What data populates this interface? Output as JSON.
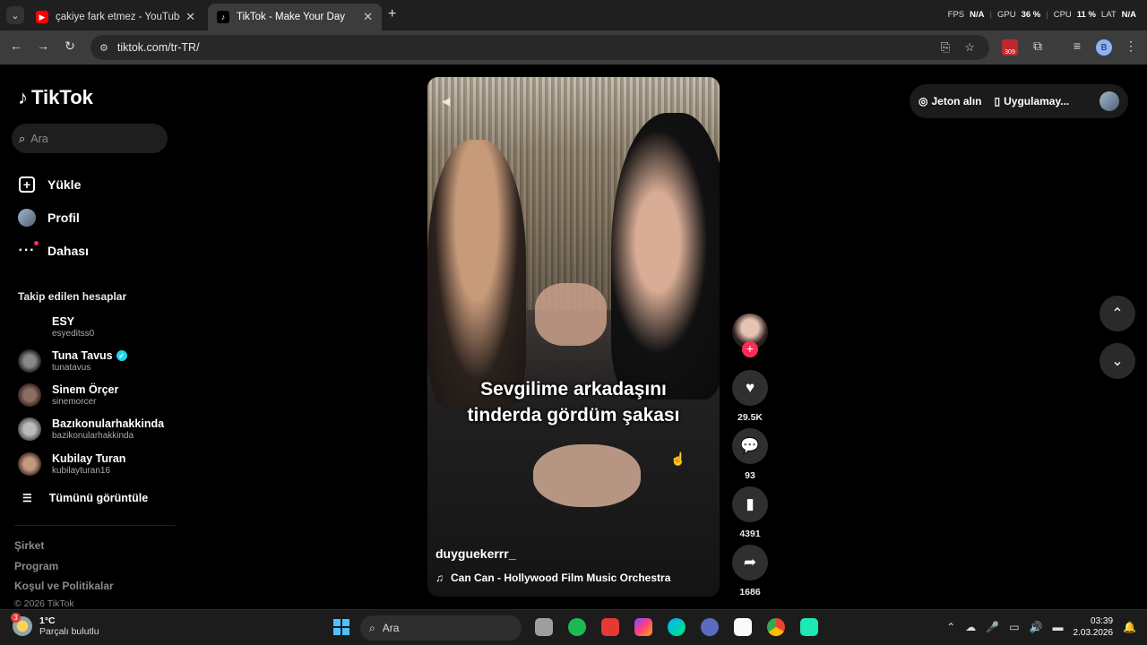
{
  "browser": {
    "tabs": [
      {
        "title": "çakiye fark etmez - YouTube",
        "favicon": "youtube-icon",
        "active": false
      },
      {
        "title": "TikTok - Make Your Day",
        "favicon": "tiktok-icon",
        "active": true
      }
    ],
    "url": "tiktok.com/tr-TR/",
    "extension_badge": "309",
    "profile_initial": "B",
    "perf": {
      "fps_label": "FPS",
      "fps_value": "N/A",
      "gpu_label": "GPU",
      "gpu_value": "36 %",
      "cpu_label": "CPU",
      "cpu_value": "11 %",
      "lat_label": "LAT",
      "lat_value": "N/A"
    }
  },
  "sidebar": {
    "logo": "TikTok",
    "search_placeholder": "Ara",
    "menu": [
      {
        "label": "Yükle",
        "icon": "upload-icon"
      },
      {
        "label": "Profil",
        "icon": "avatar"
      },
      {
        "label": "Dahası",
        "icon": "more-icon"
      }
    ],
    "following_header": "Takip edilen hesaplar",
    "following": [
      {
        "name": "ESY",
        "handle": "esyeditss0",
        "verified": false
      },
      {
        "name": "Tuna Tavus",
        "handle": "tunatavus",
        "verified": true
      },
      {
        "name": "Sinem Örçer",
        "handle": "sinemorcer",
        "verified": false
      },
      {
        "name": "Bazıkonularhakkinda",
        "handle": "bazikonularhakkinda",
        "verified": false
      },
      {
        "name": "Kubilay Turan",
        "handle": "kubilayturan16",
        "verified": false
      }
    ],
    "see_all": "Tümünü görüntüle",
    "footer_links": [
      "Şirket",
      "Program",
      "Koşul ve Politikalar"
    ],
    "copyright": "© 2026 TikTok"
  },
  "video": {
    "caption_line1": "Sevgilime arkadaşını",
    "caption_line2": "tinderda gördüm şakası",
    "author": "duyguekerrr_",
    "music": "Can Can - Hollywood Film Music Orchestra"
  },
  "actions": {
    "likes": "29.5K",
    "comments": "93",
    "saves": "4391",
    "shares": "1686"
  },
  "topbar": {
    "coins": "Jeton alın",
    "get_app": "Uygulamay..."
  },
  "taskbar": {
    "temperature": "1°C",
    "weather": "Parçalı bulutlu",
    "weather_badge": "3",
    "search": "Ara",
    "time": "03:39",
    "date": "2.03.2026"
  },
  "colors": {
    "accent": "#fe2c55",
    "verified": "#20d5ec",
    "background": "#000000"
  }
}
